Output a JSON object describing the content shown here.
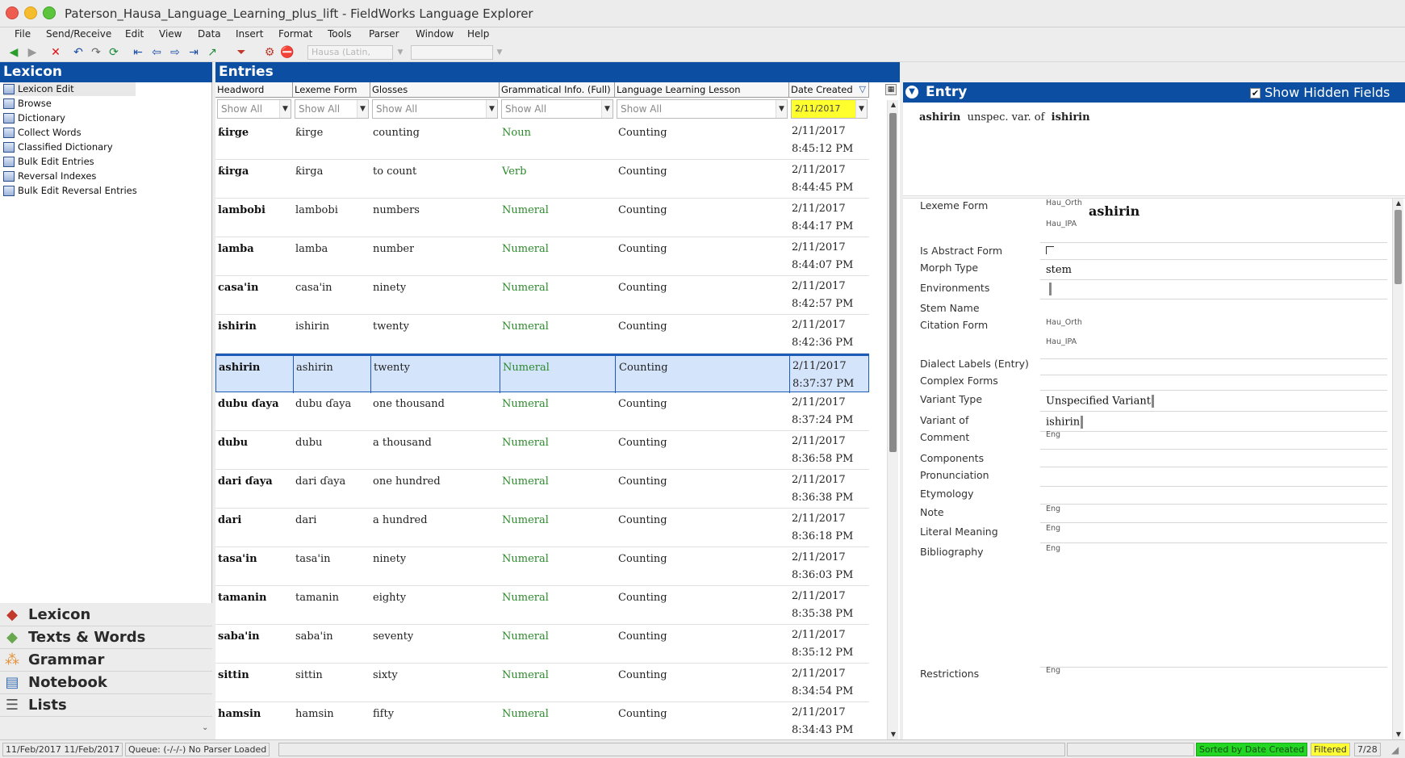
{
  "window": {
    "title": "Paterson_Hausa_Language_Learning_plus_lift - FieldWorks Language Explorer"
  },
  "menu": [
    "File",
    "Send/Receive",
    "Edit",
    "View",
    "Data",
    "Insert",
    "Format",
    "Tools",
    "Parser",
    "Window",
    "Help"
  ],
  "toolbar": {
    "writing_system_combo": "Hausa (Latin,",
    "style_combo": ""
  },
  "lexicon_pane": {
    "title": "Lexicon",
    "tools": [
      "Lexicon Edit",
      "Browse",
      "Dictionary",
      "Collect Words",
      "Classified Dictionary",
      "Bulk Edit Entries",
      "Reversal Indexes",
      "Bulk Edit Reversal Entries"
    ]
  },
  "areas": [
    "Lexicon",
    "Texts & Words",
    "Grammar",
    "Notebook",
    "Lists"
  ],
  "entries": {
    "title": "Entries",
    "columns": [
      "Headword",
      "Lexeme Form",
      "Glosses",
      "Grammatical Info. (Full)",
      "Language Learning Lesson",
      "Date Created"
    ],
    "filters": [
      "Show All",
      "Show All",
      "Show All",
      "Show All",
      "Show All",
      "2/11/2017"
    ],
    "rows": [
      {
        "headword": "ƙirge",
        "lexeme": "ƙirge",
        "gloss": "counting",
        "gram": "Noun",
        "lesson": "Counting",
        "date": "2/11/2017",
        "time": "8:45:12 PM"
      },
      {
        "headword": "ƙirga",
        "lexeme": "ƙirga",
        "gloss": "to count",
        "gram": "Verb",
        "lesson": "Counting",
        "date": "2/11/2017",
        "time": "8:44:45 PM"
      },
      {
        "headword": "lambobi",
        "lexeme": "lambobi",
        "gloss": "numbers",
        "gram": "Numeral",
        "lesson": "Counting",
        "date": "2/11/2017",
        "time": "8:44:17 PM"
      },
      {
        "headword": "lamba",
        "lexeme": "lamba",
        "gloss": "number",
        "gram": "Numeral",
        "lesson": "Counting",
        "date": "2/11/2017",
        "time": "8:44:07 PM"
      },
      {
        "headword": "casa'in",
        "lexeme": "casa'in",
        "gloss": "ninety",
        "gram": "Numeral",
        "lesson": "Counting",
        "date": "2/11/2017",
        "time": "8:42:57 PM"
      },
      {
        "headword": "ishirin",
        "lexeme": "ishirin",
        "gloss": "twenty",
        "gram": "Numeral",
        "lesson": "Counting",
        "date": "2/11/2017",
        "time": "8:42:36 PM"
      },
      {
        "headword": "ashirin",
        "lexeme": "ashirin",
        "gloss": "twenty",
        "gram": "Numeral",
        "lesson": "Counting",
        "date": "2/11/2017",
        "time": "8:37:37 PM",
        "selected": true
      },
      {
        "headword": "dubu ɗaya",
        "lexeme": "dubu ɗaya",
        "gloss": "one thousand",
        "gram": "Numeral",
        "lesson": "Counting",
        "date": "2/11/2017",
        "time": "8:37:24 PM"
      },
      {
        "headword": "dubu",
        "lexeme": "dubu",
        "gloss": "a thousand",
        "gram": "Numeral",
        "lesson": "Counting",
        "date": "2/11/2017",
        "time": "8:36:58 PM"
      },
      {
        "headword": "dari ɗaya",
        "lexeme": "dari ɗaya",
        "gloss": "one hundred",
        "gram": "Numeral",
        "lesson": "Counting",
        "date": "2/11/2017",
        "time": "8:36:38 PM"
      },
      {
        "headword": "dari",
        "lexeme": "dari",
        "gloss": "a hundred",
        "gram": "Numeral",
        "lesson": "Counting",
        "date": "2/11/2017",
        "time": "8:36:18 PM"
      },
      {
        "headword": "tasa'in",
        "lexeme": "tasa'in",
        "gloss": "ninety",
        "gram": "Numeral",
        "lesson": "Counting",
        "date": "2/11/2017",
        "time": "8:36:03 PM"
      },
      {
        "headword": "tamanin",
        "lexeme": "tamanin",
        "gloss": "eighty",
        "gram": "Numeral",
        "lesson": "Counting",
        "date": "2/11/2017",
        "time": "8:35:38 PM"
      },
      {
        "headword": "saba'in",
        "lexeme": "saba'in",
        "gloss": "seventy",
        "gram": "Numeral",
        "lesson": "Counting",
        "date": "2/11/2017",
        "time": "8:35:12 PM"
      },
      {
        "headword": "sittin",
        "lexeme": "sittin",
        "gloss": "sixty",
        "gram": "Numeral",
        "lesson": "Counting",
        "date": "2/11/2017",
        "time": "8:34:54 PM"
      },
      {
        "headword": "hamsin",
        "lexeme": "hamsin",
        "gloss": "fifty",
        "gram": "Numeral",
        "lesson": "Counting",
        "date": "2/11/2017",
        "time": "8:34:43 PM"
      }
    ]
  },
  "entry": {
    "title": "Entry",
    "show_hidden_label": "Show Hidden Fields",
    "summary": {
      "headword": "ashirin",
      "relation": "unspec. var. of",
      "target": "ishirin"
    },
    "fields": {
      "lexeme_form": "Lexeme Form",
      "ws_orth": "Hau_Orth",
      "ws_ipa": "Hau_IPA",
      "lexeme_value": "ashirin",
      "is_abstract": "Is Abstract Form",
      "morph_type": "Morph Type",
      "morph_type_value": "stem",
      "environments": "Environments",
      "stem_name": "Stem Name",
      "citation_form": "Citation Form",
      "dialect_labels": "Dialect Labels (Entry)",
      "complex_forms": "Complex Forms",
      "variant_type": "Variant Type",
      "variant_type_value": "Unspecified Variant",
      "variant_of": "Variant of",
      "variant_of_value": "ishirin",
      "comment": "Comment",
      "ws_eng": "Eng",
      "components": "Components",
      "pronunciation": "Pronunciation",
      "etymology": "Etymology",
      "note": "Note",
      "literal_meaning": "Literal Meaning",
      "bibliography": "Bibliography",
      "restrictions": "Restrictions"
    }
  },
  "status": {
    "dates": "11/Feb/2017 11/Feb/2017",
    "parser": "Queue: (-/-/-) No Parser Loaded",
    "sorted": "Sorted by Date Created",
    "filtered": "Filtered",
    "position": "7/28"
  },
  "colors": {
    "header_blue": "#0b4ea2",
    "gram_green": "#2a8a2a",
    "selection": "#d4e4fb",
    "filter_highlight": "#ffff2e"
  }
}
